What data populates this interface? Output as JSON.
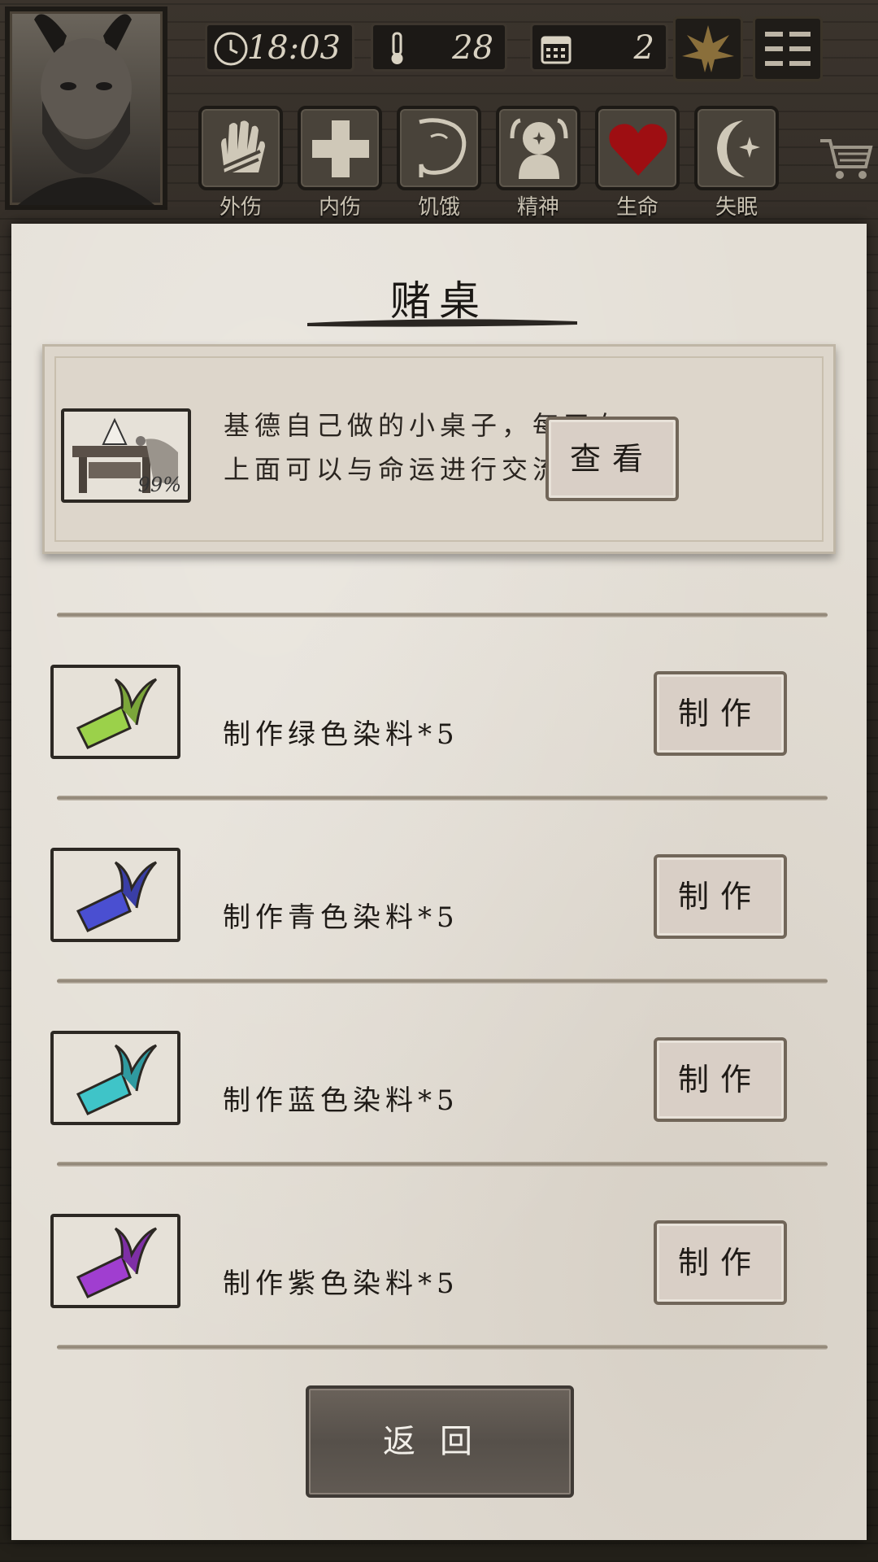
{
  "hud": {
    "time": "18:03",
    "temperature": "28",
    "day": "2",
    "status_icons": [
      {
        "label": "外伤",
        "icon": "hand-icon"
      },
      {
        "label": "内伤",
        "icon": "cross-icon"
      },
      {
        "label": "饥饿",
        "icon": "stomach-icon"
      },
      {
        "label": "精神",
        "icon": "mind-icon"
      },
      {
        "label": "生命",
        "icon": "heart-icon"
      },
      {
        "label": "失眠",
        "icon": "moon-star-icon"
      }
    ]
  },
  "panel": {
    "title": "赌桌",
    "description": {
      "text": "基德自己做的小桌子，每天在上面可以与命运进行交流。",
      "progress_label": "99%",
      "button_label": "查看"
    },
    "recipes": [
      {
        "label": "制作绿色染料*5",
        "button_label": "制作",
        "color": "#9bd14a"
      },
      {
        "label": "制作青色染料*5",
        "button_label": "制作",
        "color": "#4a4fd1"
      },
      {
        "label": "制作蓝色染料*5",
        "button_label": "制作",
        "color": "#3fc4c8"
      },
      {
        "label": "制作紫色染料*5",
        "button_label": "制作",
        "color": "#a03ed0"
      }
    ],
    "back_label": "返回"
  },
  "colors": {
    "paper": "#e4dfd6",
    "button_fill": "#d9cfc6",
    "back_button": "#5e5750",
    "heart_red": "#9e0e12"
  }
}
